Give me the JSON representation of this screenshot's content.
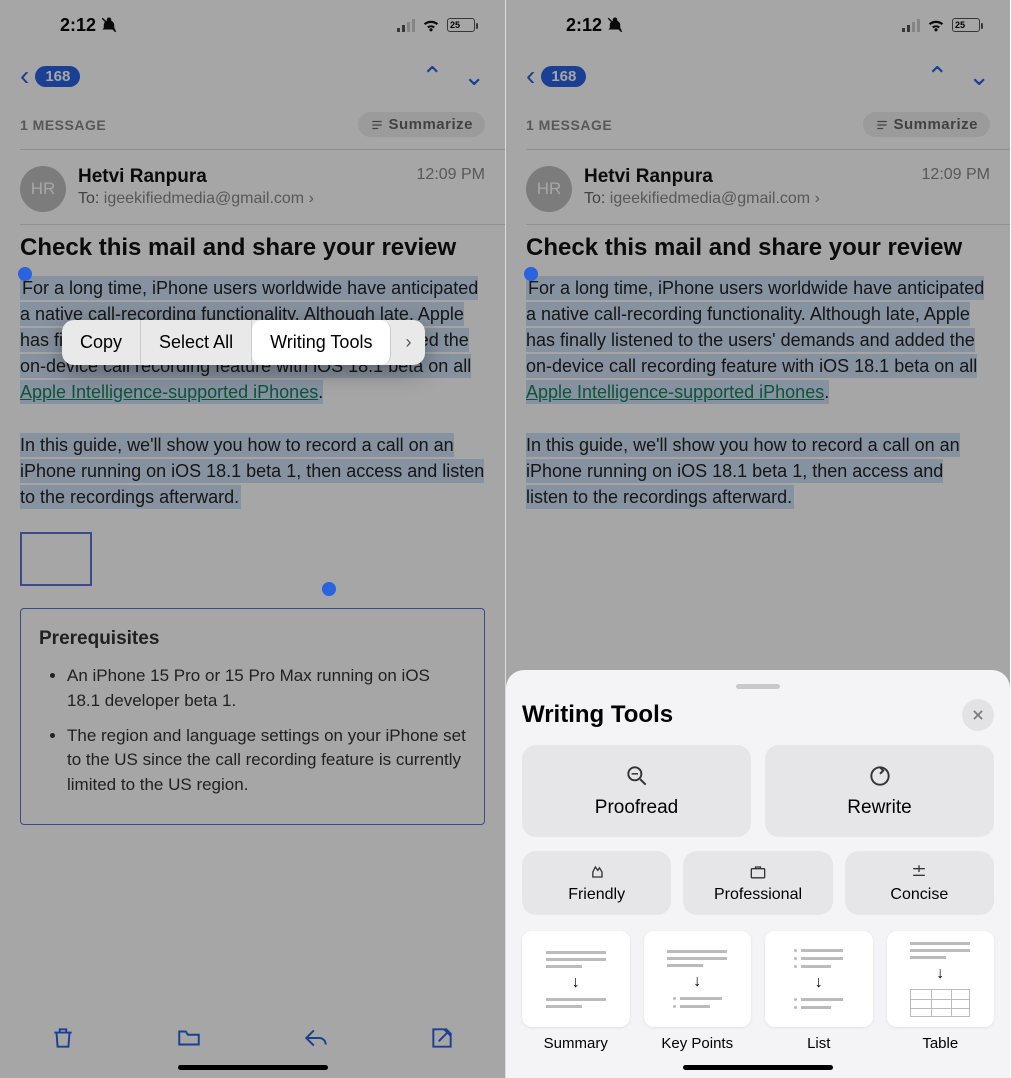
{
  "status": {
    "time": "2:12",
    "battery": "25"
  },
  "nav": {
    "count": "168"
  },
  "thread": {
    "count_label": "1 MESSAGE",
    "summarize": "Summarize"
  },
  "sender": {
    "initials": "HR",
    "name": "Hetvi Ranpura",
    "to_label": "To:",
    "to_addr": "igeekifiedmedia@gmail.com",
    "time": "12:09 PM"
  },
  "subject": "Check this mail and share your review",
  "body": {
    "p1_a": "For a long time, iPhone users worldwide have anticipated a native call-recording functionality. Although late, Apple has finally listened to the users' demands and added the on-device call recording feature with iOS 18.1 beta on all ",
    "link": "Apple Intelligence-supported iPhones",
    "p1_b": ".",
    "p2": "In this guide, we'll show you how to record a call on an iPhone running on iOS 18.1 beta 1, then access and listen to the recordings afterward."
  },
  "prereq": {
    "title": "Prerequisites",
    "items": [
      "An iPhone 15 Pro or 15 Pro Max running on iOS 18.1 developer beta 1.",
      "The region and language settings on your iPhone set to the US since the call recording feature is currently limited to the US region."
    ]
  },
  "context_menu": {
    "copy": "Copy",
    "select_all": "Select All",
    "writing_tools": "Writing Tools"
  },
  "sheet": {
    "title": "Writing Tools",
    "proofread": "Proofread",
    "rewrite": "Rewrite",
    "friendly": "Friendly",
    "professional": "Professional",
    "concise": "Concise",
    "summary": "Summary",
    "key_points": "Key Points",
    "list": "List",
    "table": "Table"
  }
}
